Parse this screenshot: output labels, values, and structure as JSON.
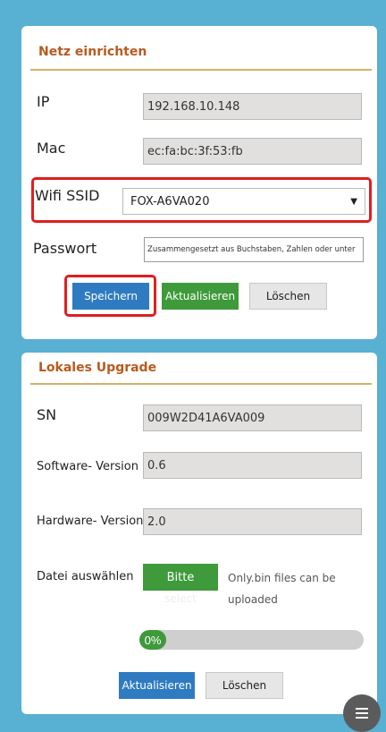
{
  "network": {
    "title": "Netz einrichten",
    "ip_label": "IP",
    "ip_value": "192.168.10.148",
    "mac_label": "Mac",
    "mac_value": "ec:fa:bc:3f:53:fb",
    "ssid_label": "Wifi SSID",
    "ssid_value": "FOX-A6VA020",
    "ssid_arrow": "▼",
    "password_label": "Passwort",
    "password_placeholder": "Zusammengesetzt aus Buchstaben, Zahlen oder unter",
    "save_label": "Speichern",
    "refresh_label": "Aktualisieren",
    "delete_label": "Löschen"
  },
  "upgrade": {
    "title": "Lokales Upgrade",
    "sn_label": "SN",
    "sn_value": "009W2D41A6VA009",
    "software_label": "Software- Version",
    "software_value": "0.6",
    "hardware_label": "Hardware- Version",
    "hardware_value": "2.0",
    "file_label": "Datei auswählen",
    "file_button_label": "Bitte",
    "file_button_faint": "select",
    "file_note_line1": "Only.bin files can be",
    "file_note_line2": "uploaded",
    "progress_label": "0%",
    "progress_value": 0,
    "refresh_label": "Aktualisieren",
    "delete_label": "Löschen"
  },
  "fab": {
    "icon": "menu-icon"
  },
  "colors": {
    "background": "#58b0d2",
    "accent_title": "#b85a1e",
    "blue_button": "#2f7bc1",
    "green_button": "#3e9a3a",
    "highlight": "#e21e1e"
  }
}
